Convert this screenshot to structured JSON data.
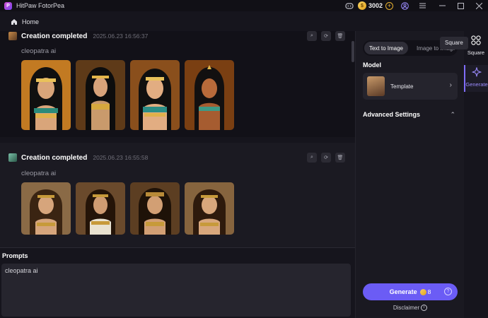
{
  "app": {
    "title": "HitPaw FotorPea",
    "coins": "3002"
  },
  "home": {
    "label": "Home"
  },
  "creations": [
    {
      "title": "Creation completed",
      "timestamp": "2025.06.23  16:56:37",
      "prompt": "cleopatra ai",
      "images": [
        {
          "name": "cleopatra-illustration-1",
          "bg": "#c27a22"
        },
        {
          "name": "cleopatra-illustration-2",
          "bg": "#5e3a18"
        },
        {
          "name": "cleopatra-illustration-3",
          "bg": "#8a4f1c"
        },
        {
          "name": "cleopatra-illustration-4",
          "bg": "#7a3f12"
        }
      ]
    },
    {
      "title": "Creation completed",
      "timestamp": "2025.06.23  16:55:58",
      "prompt": "cleopatra ai",
      "images": [
        {
          "name": "cleopatra-photo-1",
          "bg": "#8a6a46"
        },
        {
          "name": "cleopatra-photo-2",
          "bg": "#6a4a2c"
        },
        {
          "name": "cleopatra-photo-3",
          "bg": "#5c3e22"
        },
        {
          "name": "cleopatra-photo-4",
          "bg": "#86643e"
        }
      ]
    }
  ],
  "prompts": {
    "label": "Prompts",
    "value": "cleopatra ai"
  },
  "panel": {
    "tabs": [
      "Text to Image",
      "Image to Image"
    ],
    "model_heading": "Model",
    "model_name": "Template",
    "advanced_heading": "Advanced Settings",
    "generate_label": "Generate",
    "generate_cost": "8",
    "disclaimer": "Disclaimer"
  },
  "nav": {
    "square": "Square",
    "generate": "Generate",
    "tooltip": "Square"
  },
  "colors": {
    "accent": "#6b5cf5",
    "gold": "#e8b130"
  }
}
